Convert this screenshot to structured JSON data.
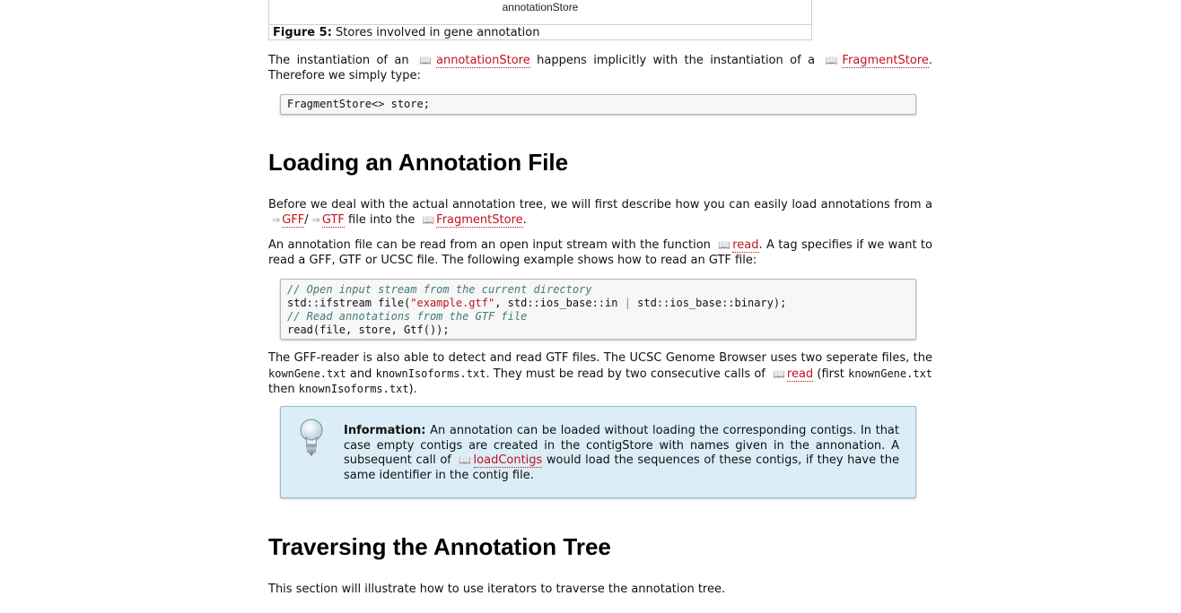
{
  "figure": {
    "store_label": "annotationStore",
    "caption_label": "Figure 5:",
    "caption_text": "Stores involved in gene annotation"
  },
  "intro": {
    "t1": "The instantiation of an ",
    "link1": "annotationStore",
    "t2": " happens implicitly with the instantiation of a ",
    "link2": "FragmentStore",
    "t3": ". Therefore we simply type:"
  },
  "code1": "FragmentStore<> store;",
  "section1": {
    "heading": "Loading an Annotation File",
    "p1": {
      "t1": "Before we deal with the actual annotation tree, we will first describe how you can easily load annotations from a ",
      "link_gff": "GFF",
      "sep": "/",
      "link_gtf": "GTF",
      "t2": " file into the ",
      "link_store": "FragmentStore",
      "t3": "."
    },
    "p2": {
      "t1": "An annotation file can be read from an open input stream with the function ",
      "link_read": "read",
      "t2": ". A tag specifies if we want to read a GFF, GTF or UCSC file. The following example shows how to read an GTF file:"
    },
    "code2": {
      "l1_comment": "// Open input stream from the current directory",
      "l2_a": "std::ifstream file(",
      "l2_str": "\"example.gtf\"",
      "l2_b": ", std::ios_base::in ",
      "l2_op": "|",
      "l2_c": " std::ios_base::binary);",
      "l3_comment": "// Read annotations from the GTF file",
      "l4": "read(file, store, Gtf());"
    },
    "p3": {
      "t1": "The GFF-reader is also able to detect and read GTF files. The UCSC Genome Browser uses two seperate files, the ",
      "code_a": "kownGene.txt",
      "t2": " and ",
      "code_b": "knownIsoforms.txt",
      "t3": ". They must be read by two consecutive calls of ",
      "link_read": "read",
      "t4": " (first ",
      "code_c": "knownGene.txt",
      "t5": " then ",
      "code_d": "knownIsoforms.txt",
      "t6": ")."
    },
    "info": {
      "label": "Information:",
      "t1": " An annotation can be loaded without loading the corresponding contigs. In that case empty contigs are created in the contigStore with names given in the annonation. A subsequent call of ",
      "link": "loadContigs",
      "t2": " would load the sequences of these contigs, if they have the same identifier in the contig file."
    }
  },
  "section2": {
    "heading": "Traversing the Annotation Tree",
    "p1": "This section will illustrate how to use iterators to traverse the annotation tree."
  },
  "icons": {
    "doc_icon": "book-icon",
    "external_icon": "arrow-link-icon",
    "info_icon": "lightbulb-icon"
  },
  "colors": {
    "link": "#c0141e",
    "info_bg": "#dbeef8",
    "comment": "#3f7a7a"
  }
}
